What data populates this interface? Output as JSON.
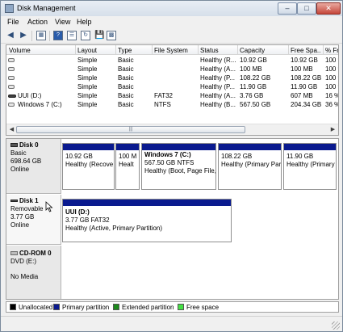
{
  "window": {
    "title": "Disk Management"
  },
  "menu": [
    "File",
    "Action",
    "View",
    "Help"
  ],
  "toolbar": {
    "back_icon": "back-arrow-icon",
    "forward_icon": "forward-arrow-icon",
    "buttons": [
      "console-tree-icon",
      "help-icon",
      "properties-icon",
      "refresh-icon",
      "rescan-icon"
    ]
  },
  "volumes": {
    "columns": [
      "Volume",
      "Layout",
      "Type",
      "File System",
      "Status",
      "Capacity",
      "Free Spa...",
      "% Fre"
    ],
    "rows": [
      {
        "volume": "",
        "layout": "Simple",
        "type": "Basic",
        "fs": "",
        "status": "Healthy (R...",
        "capacity": "10.92 GB",
        "free": "10.92 GB",
        "pct": "100 %"
      },
      {
        "volume": "",
        "layout": "Simple",
        "type": "Basic",
        "fs": "",
        "status": "Healthy (A...",
        "capacity": "100 MB",
        "free": "100 MB",
        "pct": "100 %"
      },
      {
        "volume": "",
        "layout": "Simple",
        "type": "Basic",
        "fs": "",
        "status": "Healthy (P...",
        "capacity": "108.22 GB",
        "free": "108.22 GB",
        "pct": "100 %"
      },
      {
        "volume": "",
        "layout": "Simple",
        "type": "Basic",
        "fs": "",
        "status": "Healthy (P...",
        "capacity": "11.90 GB",
        "free": "11.90 GB",
        "pct": "100 %"
      },
      {
        "volume": "UUI (D:)",
        "layout": "Simple",
        "type": "Basic",
        "fs": "FAT32",
        "status": "Healthy (A...",
        "capacity": "3.76 GB",
        "free": "607 MB",
        "pct": "16 %"
      },
      {
        "volume": "Windows 7 (C:)",
        "layout": "Simple",
        "type": "Basic",
        "fs": "NTFS",
        "status": "Healthy (B...",
        "capacity": "567.50 GB",
        "free": "204.34 GB",
        "pct": "36 %"
      }
    ],
    "scroll_grip": "|||"
  },
  "disks": [
    {
      "name": "Disk 0",
      "kind": "Basic",
      "size": "698.64 GB",
      "state": "Online",
      "partitions": [
        {
          "title": "",
          "line1": "10.92 GB",
          "line2": "Healthy (Recove"
        },
        {
          "title": "",
          "line1": "100 M",
          "line2": "Healt"
        },
        {
          "title": "Windows 7  (C:)",
          "line1": "567.50 GB NTFS",
          "line2": "Healthy (Boot, Page File,"
        },
        {
          "title": "",
          "line1": "108.22 GB",
          "line2": "Healthy (Primary Par"
        },
        {
          "title": "",
          "line1": "11.90 GB",
          "line2": "Healthy (Primary"
        }
      ]
    },
    {
      "name": "Disk 1",
      "kind": "Removable",
      "size": "3.77 GB",
      "state": "Online",
      "partitions": [
        {
          "title": "UUI  (D:)",
          "line1": "3.77 GB FAT32",
          "line2": "Healthy (Active, Primary Partition)"
        }
      ]
    },
    {
      "name": "CD-ROM 0",
      "kind": "DVD (E:)",
      "size": "",
      "state": "No Media",
      "partitions": []
    }
  ],
  "legend": [
    {
      "label": "Unallocated",
      "color": "#000000"
    },
    {
      "label": "Primary partition",
      "color": "#0a1a8f"
    },
    {
      "label": "Extended partition",
      "color": "#1b8a1b"
    },
    {
      "label": "Free space",
      "color": "#44e044"
    }
  ]
}
